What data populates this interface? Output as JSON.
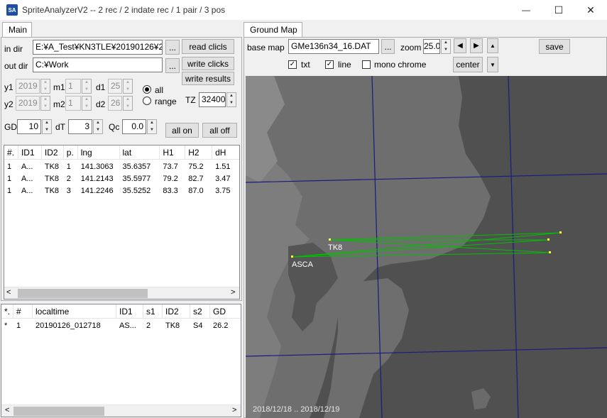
{
  "window": {
    "app_icon_text": "SA",
    "title": "SpriteAnalyzerV2 --  2 rec  / 2 indate rec / 1 pair / 3 pos",
    "minimize": "—",
    "maximize": "☐",
    "close": "✕"
  },
  "main_tab": {
    "label": "Main",
    "in_dir_label": "in dir",
    "in_dir_value": "E:¥A_Test¥KN3TLE¥20190126¥2",
    "out_dir_label": "out dir",
    "out_dir_value": "C:¥Work",
    "browse_label": "...",
    "read_clicks": "read clicls",
    "write_clicks": "write clicks",
    "write_results": "write results",
    "y1_label": "y1",
    "y1_value": "2019",
    "m1_label": "m1",
    "m1_value": "1",
    "d1_label": "d1",
    "d1_value": "25",
    "y2_label": "y2",
    "y2_value": "2019",
    "m2_label": "m2",
    "m2_value": "1",
    "d2_label": "d2",
    "d2_value": "26",
    "radio_all": "all",
    "radio_range": "range",
    "tz_label": "TZ",
    "tz_value": "32400",
    "gd_label": "GD",
    "gd_value": "10",
    "dt_label": "dT",
    "dt_value": "3",
    "qc_label": "Qc",
    "qc_value": "0.0",
    "all_on": "all on",
    "all_off": "all off"
  },
  "pos_table": {
    "headers": [
      "#.",
      "ID1",
      "ID2",
      "p.",
      "lng",
      "lat",
      "H1",
      "H2",
      "dH"
    ],
    "rows": [
      [
        "1",
        "A...",
        "TK8",
        "1",
        "141.3063",
        "35.6357",
        "73.7",
        "75.2",
        "1.51"
      ],
      [
        "1",
        "A...",
        "TK8",
        "2",
        "141.2143",
        "35.5977",
        "79.2",
        "82.7",
        "3.47"
      ],
      [
        "1",
        "A...",
        "TK8",
        "3",
        "141.2246",
        "35.5252",
        "83.3",
        "87.0",
        "3.75"
      ]
    ],
    "scroll_left": "<",
    "scroll_right": ">"
  },
  "pair_table": {
    "headers": [
      "*.",
      "#",
      "localtime",
      "ID1",
      "s1",
      "ID2",
      "s2",
      "GD"
    ],
    "rows": [
      [
        "*",
        "1",
        "20190126_012718",
        "AS...",
        "2",
        "TK8",
        "S4",
        "26.2"
      ]
    ],
    "scroll_left": "<",
    "scroll_right": ">"
  },
  "ground_map_tab": {
    "label": "Ground Map",
    "base_map_label": "base map",
    "base_map_value": "GMe136n34_16.DAT",
    "browse_label": "...",
    "zoom_label": "zoom",
    "zoom_value": "25.0",
    "left_arrow": "◀",
    "right_arrow": "▶",
    "up_arrow": "▲",
    "down_arrow": "▼",
    "save": "save",
    "center": "center",
    "txt_label": "txt",
    "line_label": "line",
    "mono_label": "mono chrome",
    "check_mark": "✓"
  },
  "map": {
    "station_1": "TK8",
    "station_2": "ASCA",
    "date_range": "2018/12/18 .. 2018/12/19",
    "line_color": "#00c000",
    "point_color": "#ffff33",
    "grid_color": "#1a1a80"
  }
}
